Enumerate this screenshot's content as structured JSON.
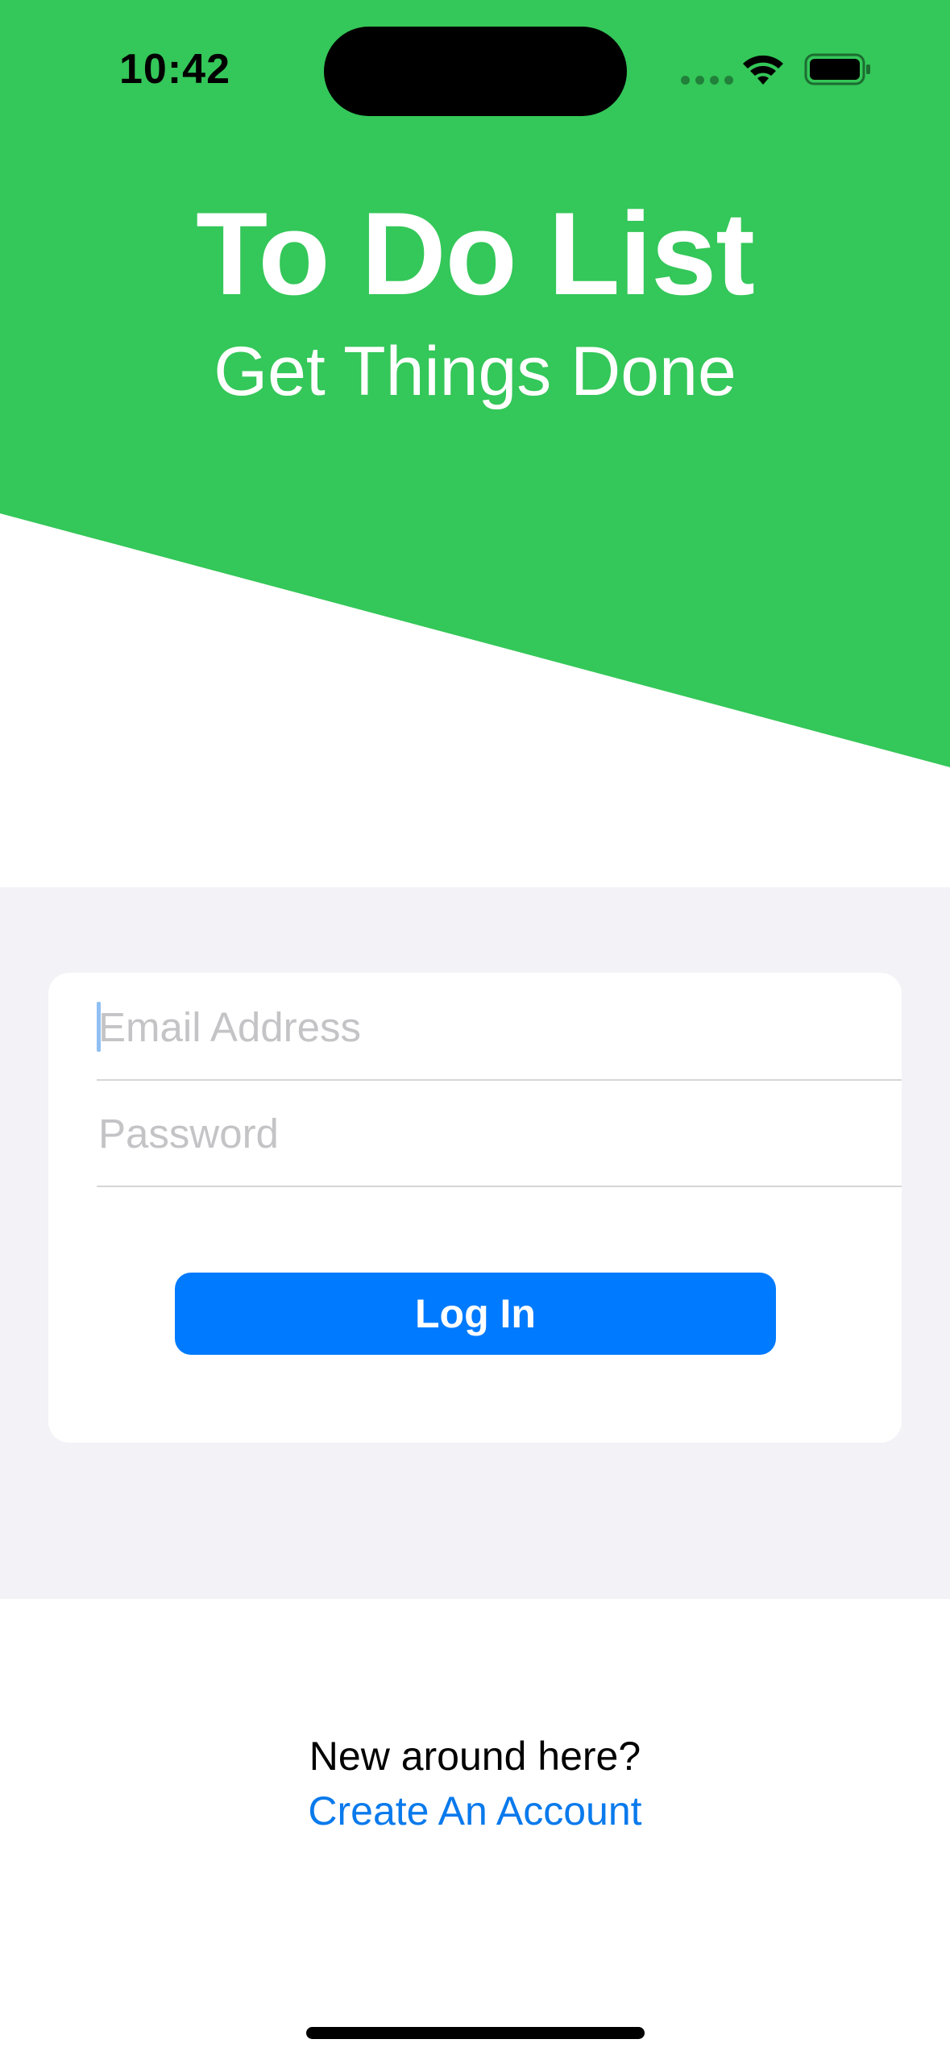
{
  "status_bar": {
    "time": "10:42",
    "icons": [
      "cellular-icon",
      "wifi-icon",
      "battery-icon"
    ]
  },
  "header": {
    "title": "To Do List",
    "subtitle": "Get Things Done",
    "background_color": "#34c759"
  },
  "login_form": {
    "email_placeholder": "Email Address",
    "email_value": "",
    "password_placeholder": "Password",
    "password_value": "",
    "login_label": "Log In",
    "button_color": "#007aff",
    "section_background": "#f2f2f7"
  },
  "footer": {
    "prompt": "New around here?",
    "create_account_label": "Create An Account",
    "link_color": "#0a7aec"
  }
}
